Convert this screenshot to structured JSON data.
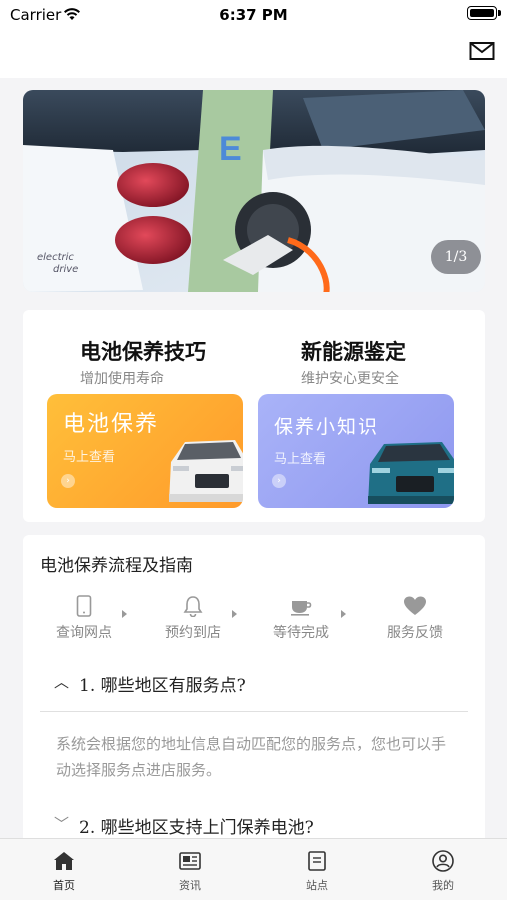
{
  "status_bar": {
    "carrier": "Carrier",
    "time": "6:37 PM"
  },
  "banner": {
    "counter": "1/3"
  },
  "tips": {
    "left": {
      "title": "电池保养技巧",
      "subtitle": "增加使用寿命"
    },
    "right": {
      "title": "新能源鉴定",
      "subtitle": "维护安心更安全"
    },
    "promo_left": {
      "title": "电池保养",
      "subtitle": "马上查看"
    },
    "promo_right": {
      "title": "保养小知识",
      "subtitle": "马上查看"
    }
  },
  "guide": {
    "title": "电池保养流程及指南",
    "steps": [
      {
        "label": "查询网点",
        "icon": "phone-icon"
      },
      {
        "label": "预约到店",
        "icon": "bell-icon"
      },
      {
        "label": "等待完成",
        "icon": "cup-icon"
      },
      {
        "label": "服务反馈",
        "icon": "heart-icon"
      }
    ],
    "faqs": [
      {
        "question": "1. 哪些地区有服务点?",
        "answer": "系统会根据您的地址信息自动匹配您的服务点，您也可以手动选择服务点进店服务。",
        "expanded": true
      },
      {
        "question": "2. 哪些地区支持上门保养电池?",
        "expanded": false
      }
    ]
  },
  "tab_bar": {
    "items": [
      {
        "label": "首页",
        "icon": "home-icon",
        "active": true
      },
      {
        "label": "资讯",
        "icon": "news-icon",
        "active": false
      },
      {
        "label": "站点",
        "icon": "station-icon",
        "active": false
      },
      {
        "label": "我的",
        "icon": "profile-icon",
        "active": false
      }
    ]
  },
  "colors": {
    "promo_orange": "#ff9a2a",
    "promo_purple": "#8e97ef",
    "car_charging_plug": "#ff6a1a"
  }
}
